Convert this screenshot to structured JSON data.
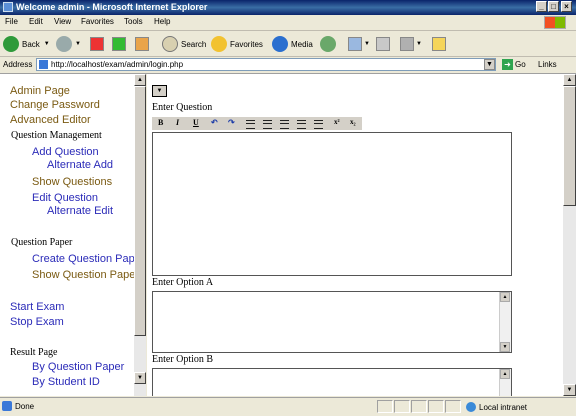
{
  "window": {
    "title": "Welcome admin - Microsoft Internet Explorer",
    "min": "_",
    "max": "□",
    "close": "×"
  },
  "menu": [
    "File",
    "Edit",
    "View",
    "Favorites",
    "Tools",
    "Help"
  ],
  "toolbar": {
    "back": "Back",
    "search": "Search",
    "favorites": "Favorites",
    "media": "Media"
  },
  "address": {
    "label": "Address",
    "url": "http://localhost/exam/admin/login.php",
    "go": "Go",
    "links": "Links"
  },
  "sidebar": {
    "admin_page": "Admin Page",
    "change_password": "Change Password",
    "advanced_editor": "Advanced Editor",
    "question_management": "Question Management",
    "add_question": "Add Question",
    "alternate_add": "Alternate Add",
    "show_questions": "Show Questions",
    "edit_question": "Edit Question",
    "alternate_edit": "Alternate Edit",
    "question_paper": "Question Paper",
    "create_question_paper": "Create Question Paper",
    "show_question_paper": "Show Question Paper",
    "start_exam": "Start Exam",
    "stop_exam": "Stop Exam",
    "result_page": "Result Page",
    "by_question_paper": "By Question Paper",
    "by_student_id": "By Student ID"
  },
  "main": {
    "enter_question": "Enter Question",
    "enter_option_a": "Enter Option A",
    "enter_option_b": "Enter Option B",
    "editor_buttons": [
      "B",
      "I",
      "U",
      "↶",
      "↷",
      "x²",
      "x₂"
    ]
  },
  "status": {
    "text": "Done",
    "zone": "Local intranet"
  }
}
